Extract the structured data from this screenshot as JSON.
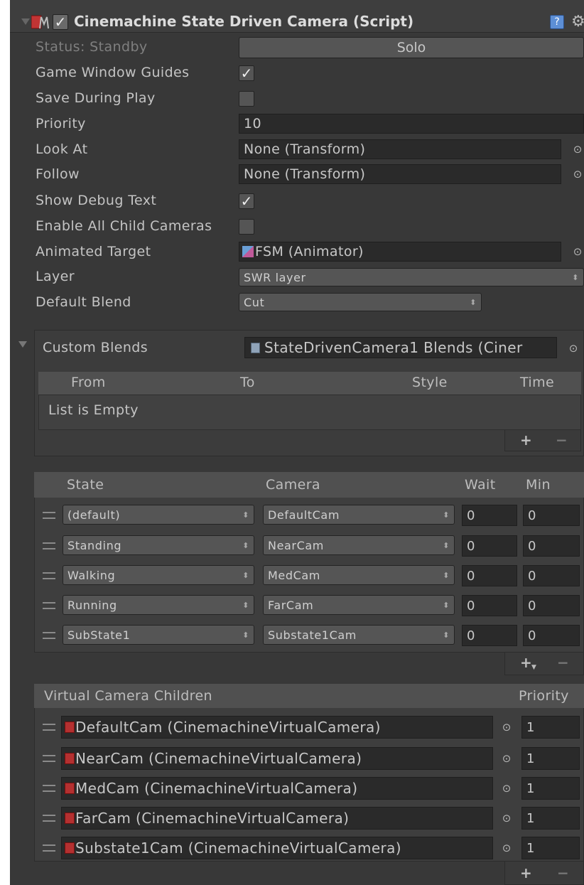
{
  "header": {
    "title": "Cinemachine State Driven Camera (Script)"
  },
  "props": {
    "status": "Status: Standby",
    "solo_label": "Solo",
    "game_window_guides": "Game Window Guides",
    "save_during_play": "Save During Play",
    "priority_label": "Priority",
    "priority_value": "10",
    "look_at_label": "Look At",
    "look_at_value": "None (Transform)",
    "follow_label": "Follow",
    "follow_value": "None (Transform)",
    "show_debug_text": "Show Debug Text",
    "enable_all_child": "Enable All Child Cameras",
    "animated_target_label": "Animated Target",
    "animated_target_value": "FSM (Animator)",
    "layer_label": "Layer",
    "layer_value": "SWR layer",
    "default_blend_label": "Default Blend",
    "default_blend_value": "Cut",
    "game_window_guides_checked": true,
    "save_during_play_checked": false,
    "show_debug_text_checked": true,
    "enable_all_child_checked": false
  },
  "custom_blends": {
    "label": "Custom Blends",
    "asset": "StateDrivenCamera1 Blends (Ciner",
    "columns": [
      "From",
      "To",
      "Style",
      "Time"
    ],
    "empty_text": "List is Empty",
    "plus": "+",
    "minus": "−"
  },
  "instructions": {
    "columns": [
      "State",
      "Camera",
      "Wait",
      "Min"
    ],
    "rows": [
      {
        "state": "(default)",
        "camera": "DefaultCam",
        "wait": "0",
        "min": "0"
      },
      {
        "state": "Standing",
        "camera": "NearCam",
        "wait": "0",
        "min": "0"
      },
      {
        "state": "Walking",
        "camera": "MedCam",
        "wait": "0",
        "min": "0"
      },
      {
        "state": "Running",
        "camera": "FarCam",
        "wait": "0",
        "min": "0"
      },
      {
        "state": "SubState1",
        "camera": "Substate1Cam",
        "wait": "0",
        "min": "0"
      }
    ],
    "plus": "+",
    "minus": "−"
  },
  "children": {
    "label": "Virtual Camera Children",
    "priority_label": "Priority",
    "rows": [
      {
        "name": "DefaultCam (CinemachineVirtualCamera)",
        "priority": "1"
      },
      {
        "name": "NearCam (CinemachineVirtualCamera)",
        "priority": "1"
      },
      {
        "name": "MedCam (CinemachineVirtualCamera)",
        "priority": "1"
      },
      {
        "name": "FarCam (CinemachineVirtualCamera)",
        "priority": "1"
      },
      {
        "name": "Substate1Cam (CinemachineVirtualCamera)",
        "priority": "1"
      }
    ],
    "plus": "+",
    "minus": "−"
  },
  "colors": {
    "panel_bg": "#383838",
    "field_bg": "#2a2a2a",
    "brand_red": "#b43030"
  },
  "icons": {
    "foldout": "triangle-down-icon",
    "component": "cinemachine-icon",
    "help": "help-book-icon",
    "settings": "gear-icon",
    "picker": "object-picker-icon"
  }
}
